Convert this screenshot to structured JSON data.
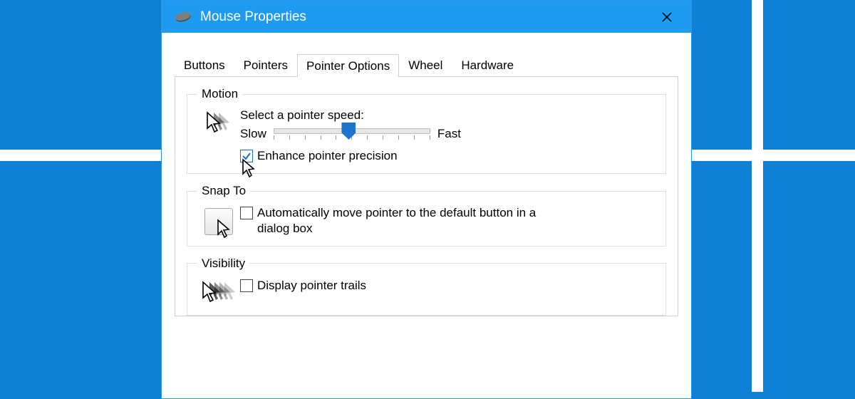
{
  "window": {
    "title": "Mouse Properties"
  },
  "tabs": [
    {
      "label": "Buttons",
      "active": false
    },
    {
      "label": "Pointers",
      "active": false
    },
    {
      "label": "Pointer Options",
      "active": true
    },
    {
      "label": "Wheel",
      "active": false
    },
    {
      "label": "Hardware",
      "active": false
    }
  ],
  "motion": {
    "legend": "Motion",
    "speed_label": "Select a pointer speed:",
    "slow_label": "Slow",
    "fast_label": "Fast",
    "enhance": {
      "checked": true,
      "label": "Enhance pointer precision"
    }
  },
  "snap": {
    "legend": "Snap To",
    "auto": {
      "checked": false,
      "label": "Automatically move pointer to the default button in a dialog box"
    }
  },
  "visibility": {
    "legend": "Visibility",
    "trails": {
      "checked": false,
      "label": "Display pointer trails"
    }
  }
}
